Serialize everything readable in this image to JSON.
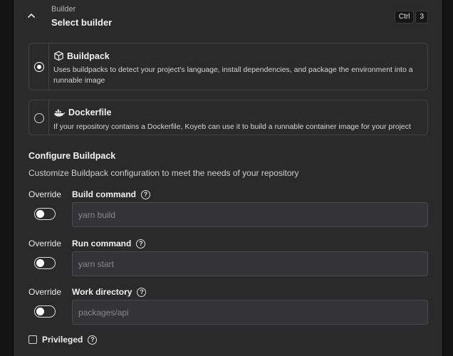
{
  "header": {
    "eyebrow": "Builder",
    "title": "Select builder",
    "shortcut": [
      "Ctrl",
      "3"
    ]
  },
  "builder_options": [
    {
      "title": "Buildpack",
      "description": "Uses buildpacks to detect your project's language, install dependencies, and package the environment into a runnable image",
      "selected": true,
      "icon": "cube-icon"
    },
    {
      "title": "Dockerfile",
      "description": "If your repository contains a Dockerfile, Koyeb can use it to build a runnable container image for your project",
      "selected": false,
      "icon": "docker-icon"
    }
  ],
  "configure": {
    "title": "Configure Buildpack",
    "subtitle": "Customize Buildpack configuration to meet the needs of your repository"
  },
  "fields": [
    {
      "override_label": "Override",
      "label": "Build command",
      "placeholder": "yarn build",
      "override_on": false
    },
    {
      "override_label": "Override",
      "label": "Run command",
      "placeholder": "yarn start",
      "override_on": false
    },
    {
      "override_label": "Override",
      "label": "Work directory",
      "placeholder": "packages/api",
      "override_on": false
    }
  ],
  "privileged": {
    "label": "Privileged",
    "checked": false
  },
  "help_glyph": "?",
  "colors": {
    "panel": "#2a2a2b",
    "background": "#141414",
    "border": "#434345"
  }
}
